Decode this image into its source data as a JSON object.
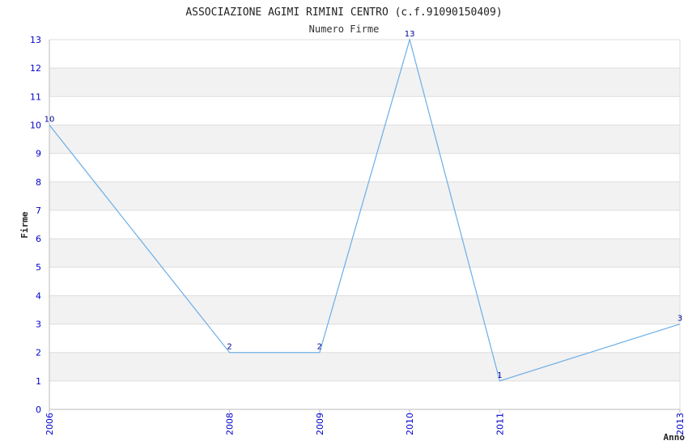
{
  "chart_data": {
    "type": "line",
    "title": "ASSOCIAZIONE AGIMI RIMINI CENTRO (c.f.91090150409)",
    "subtitle": "Numero Firme",
    "xlabel": "Anno",
    "ylabel": "Firme",
    "x": [
      2006,
      2008,
      2009,
      2010,
      2011,
      2013
    ],
    "series": [
      {
        "values": [
          10,
          2,
          2,
          13,
          1,
          3
        ]
      }
    ],
    "xlim": [
      2006,
      2013
    ],
    "ylim": [
      0,
      13
    ],
    "y_ticks": [
      0,
      1,
      2,
      3,
      4,
      5,
      6,
      7,
      8,
      9,
      10,
      11,
      12,
      13
    ],
    "x_tick_labels": [
      "2006",
      "2008",
      "2009",
      "2010",
      "2011",
      "2013"
    ],
    "grid": true,
    "legend": "none",
    "colors": {
      "line": "#6aaee8",
      "tick_text": "#0000cc",
      "data_label_text": "#000099",
      "band": "#f2f2f2",
      "grid": "#dddddd"
    }
  }
}
